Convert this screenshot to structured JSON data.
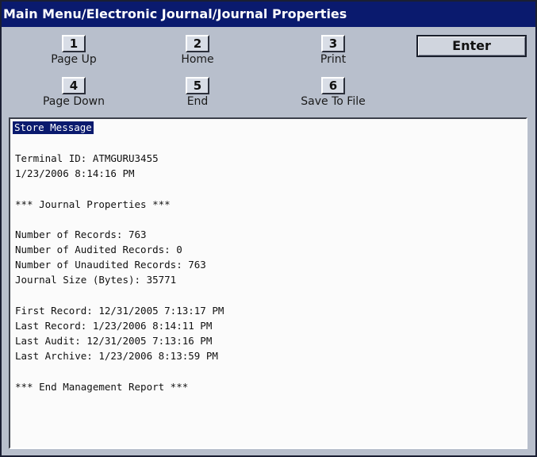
{
  "window": {
    "title": "Main Menu/Electronic Journal/Journal Properties"
  },
  "function_keys": [
    {
      "key": "1",
      "label": "Page Up"
    },
    {
      "key": "2",
      "label": "Home"
    },
    {
      "key": "3",
      "label": "Print"
    },
    {
      "key": "4",
      "label": "Page Down"
    },
    {
      "key": "5",
      "label": "End"
    },
    {
      "key": "6",
      "label": "Save To File"
    }
  ],
  "enter_button": {
    "label": "Enter"
  },
  "report": {
    "selected_line": "Store Message",
    "lines": [
      "Terminal ID: ATMGURU3455",
      "1/23/2006 8:14:16 PM",
      "*** Journal Properties ***",
      "Number of Records: 763",
      "Number of Audited Records: 0",
      "Number of Unaudited Records: 763",
      "Journal Size (Bytes): 35771",
      "First Record: 12/31/2005 7:13:17 PM",
      "Last Record: 1/23/2006 8:14:11 PM",
      "Last Audit: 12/31/2005 7:13:16 PM",
      "Last Archive: 1/23/2006 8:13:59 PM",
      "*** End Management Report ***"
    ]
  }
}
